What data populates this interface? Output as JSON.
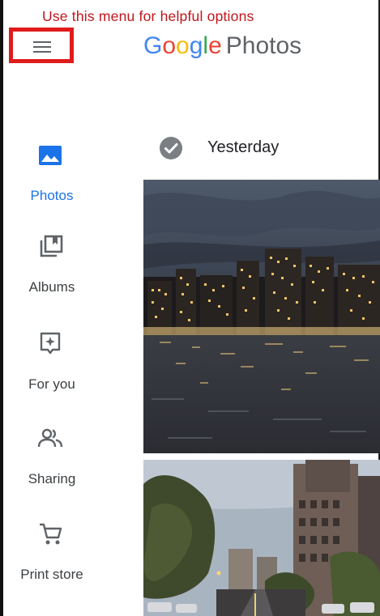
{
  "annotation": "Use this menu for helpful options",
  "header": {
    "menu_icon": "hamburger-menu-icon",
    "logo": {
      "g": "G",
      "o1": "o",
      "o2": "o",
      "g2": "g",
      "l": "l",
      "e": "e",
      "product": "Photos"
    }
  },
  "sidebar": {
    "items": [
      {
        "label": "Photos",
        "icon": "photos-icon",
        "active": true
      },
      {
        "label": "Albums",
        "icon": "albums-icon",
        "active": false
      },
      {
        "label": "For you",
        "icon": "for-you-icon",
        "active": false
      },
      {
        "label": "Sharing",
        "icon": "sharing-icon",
        "active": false
      },
      {
        "label": "Print store",
        "icon": "cart-icon",
        "active": false
      }
    ]
  },
  "main": {
    "date_group": "Yesterday",
    "select_icon": "check-circle-icon"
  },
  "colors": {
    "accent": "#1a73e8",
    "annotation": "#c0151b",
    "highlight_box": "#e01b1b"
  }
}
